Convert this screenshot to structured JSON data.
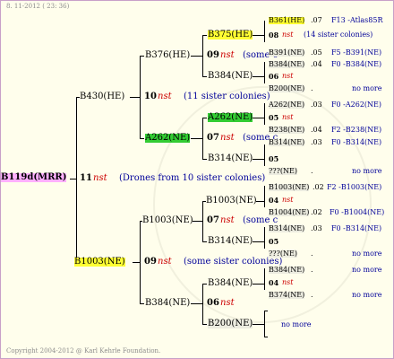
{
  "date": "8. 11-2012 ( 23: 36)",
  "copyright": "Copyright 2004-2012 @ Karl Kehrle Foundation.",
  "root": {
    "label": "B119d(MRR)",
    "gen": "11",
    "nst": "nst",
    "note": "(Drones from 10 sister colonies)"
  },
  "g10": {
    "top": {
      "label": "B430(HE)",
      "gen": "10",
      "nst": "nst",
      "note": "(11 sister colonies)"
    },
    "bot": {
      "label": "B1003(NE)",
      "gen": "09",
      "nst": "nst",
      "note": "(some sister colonies)"
    }
  },
  "g09": {
    "a": {
      "label": "B376(HE)",
      "gen": "09",
      "nst": "nst",
      "note": "(some c"
    },
    "b": {
      "label": "A262(NE)",
      "gen": "07",
      "nst": "nst",
      "note": "(some c"
    },
    "c": {
      "label": "B1003(NE)",
      "gen": "07",
      "nst": "nst",
      "note": "(some c"
    },
    "d": {
      "label": "B384(NE)",
      "gen": "06",
      "nst": "nst"
    }
  },
  "g08": [
    {
      "label": "B375(HE)",
      "gen": "08",
      "nst": "nst",
      "note": "(14 sister colonies)"
    },
    {
      "label": "B384(NE)",
      "gen": "06",
      "nst": "nst"
    },
    {
      "label": "A262(NE)",
      "gen": "05",
      "nst": "nst"
    },
    {
      "label": "B314(NE)",
      "gen": "05"
    },
    {
      "label": "B1003(NE)",
      "gen": "04",
      "nst": "nst"
    },
    {
      "label": "B314(NE)",
      "gen": "05"
    },
    {
      "label": "B384(NE)",
      "gen": "04",
      "nst": "nst"
    },
    {
      "label": "B200(NE)"
    }
  ],
  "g07": [
    {
      "label": "B361(HE)",
      "gen": ".07",
      "code": "F13 -Atlas85R"
    },
    {
      "label": "B391(NE)",
      "gen": ".05",
      "code": "F5 -B391(NE)"
    },
    {
      "label": "B384(NE)",
      "gen": ".04",
      "code": "F0 -B384(NE)"
    },
    {
      "label": "B200(NE)",
      "gen": ".",
      "code": "no more"
    },
    {
      "label": "A262(NE)",
      "gen": ".03",
      "code": "F0 -A262(NE)"
    },
    {
      "label": "B238(NE)",
      "gen": ".04",
      "code": "F2 -B238(NE)"
    },
    {
      "label": "B314(NE)",
      "gen": ".03",
      "code": "F0 -B314(NE)"
    },
    {
      "label": "???(NE)",
      "gen": ".",
      "code": "no more"
    },
    {
      "label": "B1003(NE)",
      "gen": ".02",
      "code": "F2 -B1003(NE)"
    },
    {
      "label": "B1004(NE)",
      "gen": ".02",
      "code": "F0 -B1004(NE)"
    },
    {
      "label": "B314(NE)",
      "gen": ".03",
      "code": "F0 -B314(NE)"
    },
    {
      "label": "???(NE)",
      "gen": ".",
      "code": "no more"
    },
    {
      "label": "B384(NE)",
      "gen": ".",
      "code": "no more"
    },
    {
      "label": "B374(NE)",
      "gen": ".",
      "code": "no more"
    }
  ],
  "last": {
    "code": "no more"
  }
}
